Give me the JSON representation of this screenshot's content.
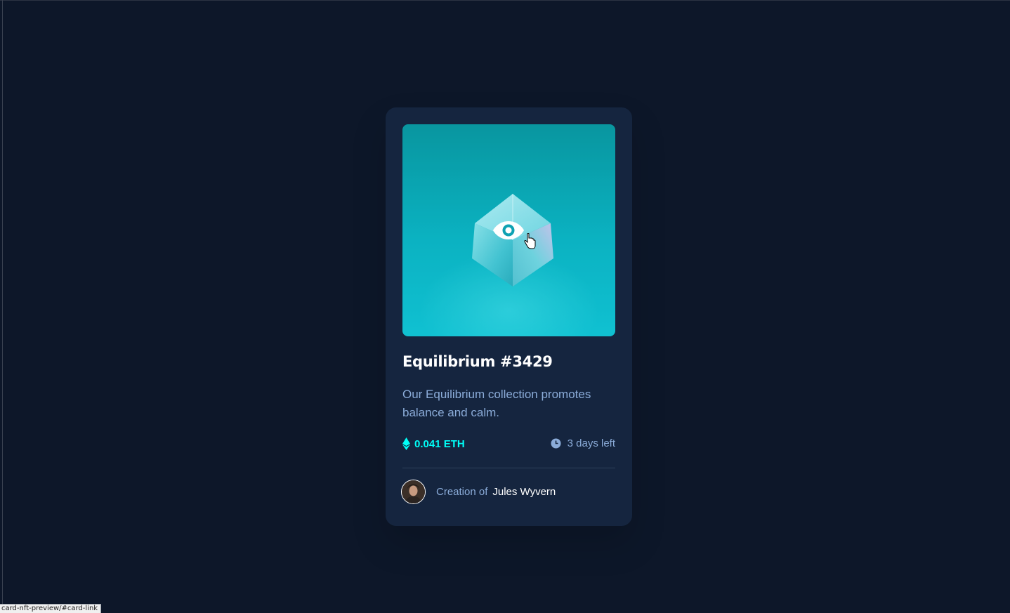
{
  "card": {
    "title": "Equilibrium #3429",
    "description": "Our Equilibrium collection promotes balance and calm.",
    "price": "0.041 ETH",
    "time_left": "3 days left",
    "creator_prefix": "Creation of",
    "creator_name": "Jules Wyvern"
  },
  "icons": {
    "ethereum": "ethereum-icon",
    "clock": "clock-icon",
    "view": "eye-icon",
    "cursor": "pointer-cursor-icon"
  },
  "status_bar": {
    "url": "card-nft-preview/#card-link"
  },
  "colors": {
    "page_bg": "#0d1729",
    "card_bg": "#15253f",
    "accent_cyan": "#00fff8",
    "soft_blue": "#8bacd9",
    "white": "#ffffff"
  }
}
